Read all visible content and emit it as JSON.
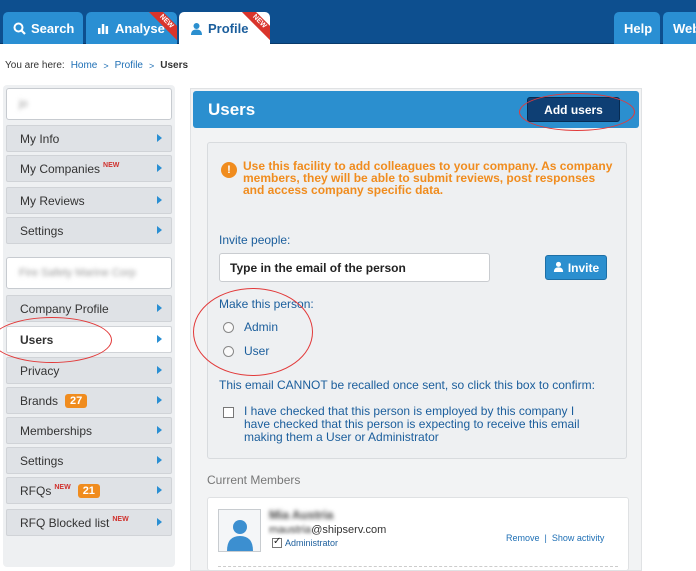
{
  "topnav": {
    "tabs": [
      {
        "label": "Search",
        "icon": "search-icon"
      },
      {
        "label": "Analyse",
        "icon": "bar-chart-icon",
        "badge": "NEW"
      },
      {
        "label": "Profile",
        "icon": "person-icon",
        "badge": "NEW"
      }
    ],
    "right": [
      {
        "label": "Help"
      },
      {
        "label": "Web"
      }
    ]
  },
  "breadcrumb": {
    "prefix": "You are here:",
    "home": "Home",
    "profile": "Profile",
    "current": "Users"
  },
  "sidebar": {
    "user_name": "jo",
    "company_name": "Fire Safety Marine Corp",
    "personal_items": [
      {
        "label": "My Info"
      },
      {
        "label": "My Companies",
        "badge": "NEW"
      },
      {
        "label": "My Reviews"
      },
      {
        "label": "Settings"
      }
    ],
    "company_items": [
      {
        "label": "Company Profile"
      },
      {
        "label": "Users"
      },
      {
        "label": "Privacy"
      },
      {
        "label": "Brands",
        "count": "27"
      },
      {
        "label": "Memberships"
      },
      {
        "label": "Settings"
      },
      {
        "label": "RFQs",
        "badge": "NEW",
        "count": "21"
      },
      {
        "label": "RFQ Blocked list",
        "badge": "NEW"
      }
    ]
  },
  "main": {
    "title": "Users",
    "add_users_label": "Add users",
    "info_text": "Use this facility to add colleagues to your company. As company members, they will be able to submit reviews, post responses and access company specific data.",
    "invite_label": "Invite people:",
    "email_placeholder": "Type in the email of the person",
    "invite_button": "Invite",
    "make_person_label": "Make this person:",
    "roles": [
      "Admin",
      "User"
    ],
    "warning": "This email CANNOT be recalled once sent, so click this box to confirm:",
    "confirm_text": "I have checked that this person is employed by this company I have checked that this person is expecting to receive this email making them a User or Administrator"
  },
  "members": {
    "label": "Current Members",
    "list": [
      {
        "name": "Mia Austria",
        "email_user": "maustria",
        "email_domain": "@shipserv.com",
        "role": "Administrator",
        "remove_label": "Remove",
        "activity_label": "Show activity"
      }
    ]
  },
  "colors": {
    "nav_bg": "#0d4f8f",
    "accent_blue": "#2b8fcf",
    "dark_button": "#0e3f74",
    "orange": "#f08c1e",
    "annotation_red": "#e23a3a"
  }
}
